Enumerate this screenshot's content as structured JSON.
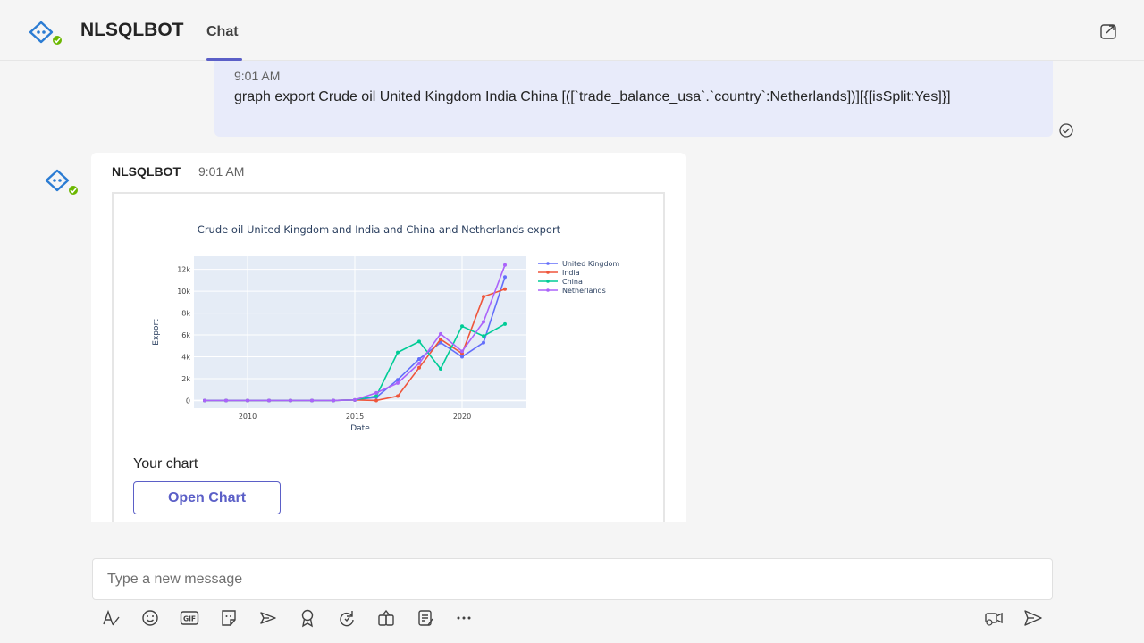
{
  "header": {
    "bot_name": "NLSQLBOT",
    "tab_label": "Chat"
  },
  "sent_message": {
    "time": "9:01 AM",
    "text": "graph export Crude oil United Kingdom India China [([`trade_balance_usa`.`country`:Netherlands])][{[isSplit:Yes]}]"
  },
  "bot_message": {
    "sender": "NLSQLBOT",
    "time": "9:01 AM",
    "caption": "Your chart",
    "button_label": "Open Chart"
  },
  "compose": {
    "placeholder": "Type a new message"
  },
  "toolbar": {
    "icons": [
      "format-icon",
      "emoji-icon",
      "gif-icon",
      "sticker-icon",
      "schedule-meeting-icon",
      "praise-icon",
      "loop-icon",
      "apps-icon",
      "notes-icon",
      "more-icon",
      "meet-now-icon",
      "send-icon"
    ]
  },
  "colors": {
    "accent": "#5b5fc7",
    "sent_bubble": "#e8ebfa",
    "plot_bg": "#e5ecf6"
  },
  "chart_data": {
    "type": "line",
    "title": "Crude oil United Kingdom and India and China and Netherlands export",
    "xlabel": "Date",
    "ylabel": "Export",
    "xlim": [
      2007.5,
      2023
    ],
    "ylim": [
      -700,
      13200
    ],
    "x_ticks": [
      2010,
      2015,
      2020
    ],
    "x_tick_labels": [
      "2010",
      "2015",
      "2020"
    ],
    "y_ticks": [
      0,
      2000,
      4000,
      6000,
      8000,
      10000,
      12000
    ],
    "y_tick_labels": [
      "0",
      "2k",
      "4k",
      "6k",
      "8k",
      "10k",
      "12k"
    ],
    "grid": true,
    "legend": "top-right-outside",
    "x": [
      2008,
      2009,
      2010,
      2011,
      2012,
      2013,
      2014,
      2015,
      2016,
      2017,
      2018,
      2019,
      2020,
      2021,
      2022
    ],
    "series": [
      {
        "name": "United Kingdom",
        "color": "#636efa",
        "values": [
          0,
          0,
          0,
          0,
          0,
          0,
          0,
          50,
          300,
          1900,
          3800,
          5300,
          4000,
          5300,
          11300
        ]
      },
      {
        "name": "India",
        "color": "#ef553b",
        "values": [
          0,
          0,
          0,
          0,
          0,
          0,
          0,
          50,
          0,
          400,
          3000,
          5600,
          4300,
          9500,
          10200
        ]
      },
      {
        "name": "China",
        "color": "#00cc96",
        "values": [
          0,
          0,
          0,
          0,
          0,
          0,
          0,
          50,
          400,
          4400,
          5400,
          2900,
          6800,
          5900,
          7000
        ]
      },
      {
        "name": "Netherlands",
        "color": "#ab63fa",
        "values": [
          0,
          0,
          0,
          0,
          0,
          0,
          0,
          50,
          700,
          1600,
          3400,
          6100,
          4500,
          7200,
          12400
        ]
      }
    ]
  }
}
